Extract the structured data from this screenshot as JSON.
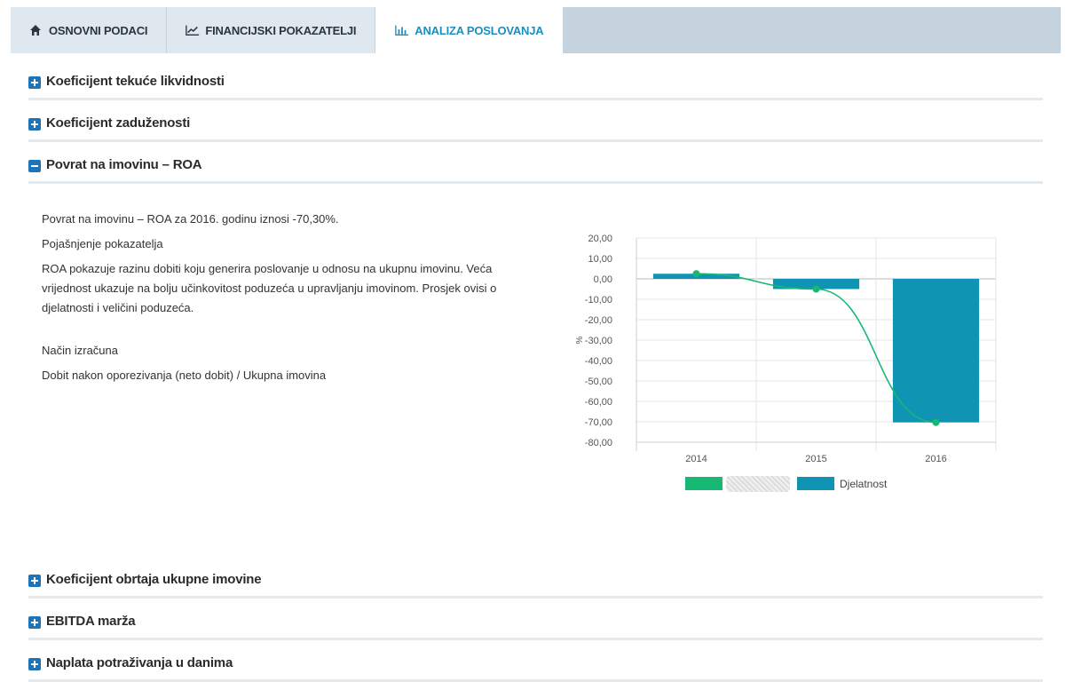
{
  "tabs": [
    {
      "label": "OSNOVNI PODACI",
      "icon": "home-icon",
      "active": false
    },
    {
      "label": "FINANCIJSKI POKAZATELJI",
      "icon": "line-chart-icon",
      "active": false
    },
    {
      "label": "ANALIZA POSLOVANJA",
      "icon": "bar-chart-icon",
      "active": true
    }
  ],
  "sections": [
    {
      "title": "Koeficijent tekuće likvidnosti",
      "expanded": false,
      "icon": "plus-icon"
    },
    {
      "title": "Koeficijent zaduženosti",
      "expanded": false,
      "icon": "plus-icon"
    },
    {
      "title": "Povrat na imovinu – ROA",
      "expanded": true,
      "icon": "minus-icon"
    },
    {
      "title": "Koeficijent obrtaja ukupne imovine",
      "expanded": false,
      "icon": "plus-icon"
    },
    {
      "title": "EBITDA marža",
      "expanded": false,
      "icon": "plus-icon"
    },
    {
      "title": "Naplata potraživanja u danima",
      "expanded": false,
      "icon": "plus-icon"
    }
  ],
  "roa": {
    "summary": "Povrat na imovinu – ROA za 2016. godinu iznosi -70,30%.",
    "explain_title": "Pojašnjenje pokazatelja",
    "explain_text": "ROA pokazuje razinu dobiti koju generira poslovanje u odnosu na ukupnu imovinu. Veća vrijednost ukazuje na bolju učinkovitost poduzeća u upravljanju imovinom. Prosjek ovisi o djelatnosti i veličini poduzeća.",
    "calc_title": "Način izračuna",
    "calc_text": "Dobit nakon oporezivanja (neto dobit) / Ukupna imovina"
  },
  "colors": {
    "accent": "#1c8fc0",
    "tab_bar": "#c5d3df",
    "section_icon": "#1f73b7",
    "line_series": "#16b874",
    "bar_series": "#0f95b3"
  },
  "chart_data": {
    "type": "bar",
    "categories": [
      "2014",
      "2015",
      "2016"
    ],
    "series": [
      {
        "name": "",
        "kind": "line",
        "color": "#16b874",
        "values": [
          2.5,
          -5.0,
          -70.3
        ]
      },
      {
        "name": "Djelatnost",
        "kind": "bar",
        "color": "#0f95b3",
        "values": [
          2.5,
          -5.0,
          -70.3
        ]
      }
    ],
    "ylabel": "%",
    "ylim": [
      -80,
      20
    ],
    "yticks": [
      "20,00",
      "10,00",
      "0,00",
      "-10,00",
      "-20,00",
      "-30,00",
      "-40,00",
      "-50,00",
      "-60,00",
      "-70,00",
      "-80,00"
    ],
    "grid": true,
    "legend": "bottom"
  }
}
